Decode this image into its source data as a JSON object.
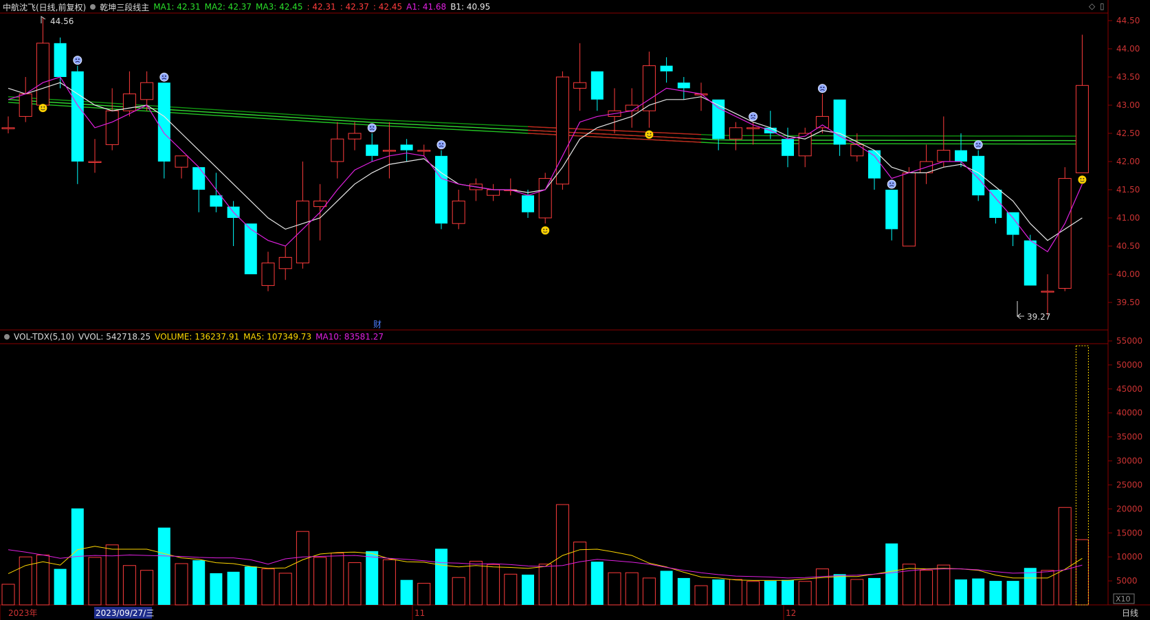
{
  "header": {
    "stock": "中航沈飞(日线,前复权)",
    "indicator": "乾坤三段线主",
    "ma1_label": "MA1: 42.31",
    "ma2_label": "MA2: 42.37",
    "ma3_label": "MA3: 42.45",
    "r1": ": 42.31",
    "r2": ": 42.37",
    "r3": ": 42.45",
    "a1_label": "A1: 41.68",
    "b1_label": "B1: 40.95"
  },
  "volume_header": {
    "name": "VOL-TDX(5,10)",
    "vvol": "VVOL: 542718.25",
    "volume": "VOLUME: 136237.91",
    "ma5": "MA5: 107349.73",
    "ma10": "MA10: 83581.27"
  },
  "annotations": {
    "high_label": "44.56",
    "low_label": "39.27",
    "fin_marker": "财"
  },
  "price_axis_ticks": [
    "44.50",
    "44.00",
    "43.50",
    "43.00",
    "42.50",
    "42.00",
    "41.50",
    "41.00",
    "40.50",
    "40.00",
    "39.50"
  ],
  "volume_axis_ticks": [
    "55000",
    "50000",
    "45000",
    "40000",
    "35000",
    "30000",
    "25000",
    "20000",
    "15000",
    "10000",
    "5000"
  ],
  "volume_multiplier": "X10",
  "date_axis": {
    "year": "2023年",
    "cursor": "2023/09/27/三",
    "m11": "11",
    "m12": "12"
  },
  "period_label": "日线",
  "colors": {
    "up": "#ff3c3c",
    "down": "#00ffff",
    "ma_white": "#e8e8e8",
    "ma_magenta": "#e020e0",
    "vol_ma5": "#ffd800",
    "grid_red": "#8a0000"
  },
  "chart_data": {
    "type": "candlestick",
    "price_range": [
      39.27,
      44.56
    ],
    "candles": [
      {
        "o": 42.6,
        "c": 42.6,
        "h": 42.8,
        "l": 42.5,
        "v": 4300,
        "m": false
      },
      {
        "o": 42.8,
        "c": 43.2,
        "h": 43.5,
        "l": 42.7,
        "v": 10000,
        "m": false
      },
      {
        "o": 43.0,
        "c": 44.1,
        "h": 44.56,
        "l": 42.9,
        "v": 10400,
        "m": true
      },
      {
        "o": 44.1,
        "c": 43.5,
        "h": 44.2,
        "l": 43.3,
        "v": 7500,
        "m": false
      },
      {
        "o": 43.6,
        "c": 42.0,
        "h": 43.7,
        "l": 41.6,
        "v": 20100,
        "m": false
      },
      {
        "o": 42.0,
        "c": 42.0,
        "h": 42.4,
        "l": 41.8,
        "v": 9900,
        "m": false
      },
      {
        "o": 42.3,
        "c": 42.9,
        "h": 43.3,
        "l": 42.2,
        "v": 12500,
        "m": false
      },
      {
        "o": 42.9,
        "c": 43.2,
        "h": 43.6,
        "l": 42.8,
        "v": 8200,
        "m": false
      },
      {
        "o": 43.1,
        "c": 43.4,
        "h": 43.6,
        "l": 42.9,
        "v": 7200,
        "m": false
      },
      {
        "o": 43.4,
        "c": 42.0,
        "h": 43.4,
        "l": 41.7,
        "v": 16100,
        "m": false
      },
      {
        "o": 41.9,
        "c": 42.1,
        "h": 42.1,
        "l": 41.7,
        "v": 8600,
        "m": false
      },
      {
        "o": 41.9,
        "c": 41.5,
        "h": 41.9,
        "l": 41.1,
        "v": 9300,
        "m": false
      },
      {
        "o": 41.4,
        "c": 41.2,
        "h": 41.8,
        "l": 41.1,
        "v": 6600,
        "m": false
      },
      {
        "o": 41.2,
        "c": 41.0,
        "h": 41.3,
        "l": 40.5,
        "v": 6900,
        "m": false
      },
      {
        "o": 40.9,
        "c": 40.0,
        "h": 40.9,
        "l": 40.0,
        "v": 8000,
        "m": false
      },
      {
        "o": 39.8,
        "c": 40.2,
        "h": 40.4,
        "l": 39.7,
        "v": 7500,
        "m": false
      },
      {
        "o": 40.1,
        "c": 40.3,
        "h": 40.5,
        "l": 39.9,
        "v": 6600,
        "m": false
      },
      {
        "o": 40.2,
        "c": 41.3,
        "h": 42.0,
        "l": 40.1,
        "v": 15300,
        "m": false
      },
      {
        "o": 41.2,
        "c": 41.3,
        "h": 41.6,
        "l": 40.6,
        "v": 9900,
        "m": false
      },
      {
        "o": 42.0,
        "c": 42.4,
        "h": 42.7,
        "l": 41.7,
        "v": 10800,
        "m": false
      },
      {
        "o": 42.4,
        "c": 42.5,
        "h": 42.7,
        "l": 42.2,
        "v": 8800,
        "m": false
      },
      {
        "o": 42.3,
        "c": 42.1,
        "h": 42.5,
        "l": 42.0,
        "v": 11200,
        "m": false
      },
      {
        "o": 42.2,
        "c": 42.2,
        "h": 42.7,
        "l": 41.7,
        "v": 9400,
        "m": false
      },
      {
        "o": 42.3,
        "c": 42.2,
        "h": 42.4,
        "l": 42.0,
        "v": 5200,
        "m": false
      },
      {
        "o": 42.2,
        "c": 42.2,
        "h": 42.3,
        "l": 42.1,
        "v": 4500,
        "m": false
      },
      {
        "o": 42.1,
        "c": 40.9,
        "h": 42.2,
        "l": 40.8,
        "v": 11700,
        "m": false
      },
      {
        "o": 40.9,
        "c": 41.3,
        "h": 41.5,
        "l": 40.8,
        "v": 5700,
        "m": false
      },
      {
        "o": 41.5,
        "c": 41.6,
        "h": 41.7,
        "l": 41.3,
        "v": 9100,
        "m": false
      },
      {
        "o": 41.4,
        "c": 41.5,
        "h": 41.6,
        "l": 41.3,
        "v": 8400,
        "m": false
      },
      {
        "o": 41.5,
        "c": 41.5,
        "h": 41.7,
        "l": 41.4,
        "v": 6400,
        "m": false
      },
      {
        "o": 41.4,
        "c": 41.1,
        "h": 41.5,
        "l": 41.0,
        "v": 6300,
        "m": false
      },
      {
        "o": 41.0,
        "c": 41.7,
        "h": 41.8,
        "l": 40.9,
        "v": 8500,
        "m": true
      },
      {
        "o": 41.6,
        "c": 43.5,
        "h": 43.6,
        "l": 41.5,
        "v": 20900,
        "m": false
      },
      {
        "o": 43.3,
        "c": 43.4,
        "h": 44.1,
        "l": 42.9,
        "v": 13100,
        "m": false
      },
      {
        "o": 43.6,
        "c": 43.1,
        "h": 43.6,
        "l": 42.9,
        "v": 9000,
        "m": false
      },
      {
        "o": 42.8,
        "c": 42.9,
        "h": 43.3,
        "l": 42.5,
        "v": 6700,
        "m": false
      },
      {
        "o": 42.9,
        "c": 43.0,
        "h": 43.3,
        "l": 42.6,
        "v": 6700,
        "m": false
      },
      {
        "o": 42.9,
        "c": 43.7,
        "h": 43.95,
        "l": 42.6,
        "v": 5600,
        "m": true
      },
      {
        "o": 43.7,
        "c": 43.6,
        "h": 43.85,
        "l": 43.4,
        "v": 7100,
        "m": false
      },
      {
        "o": 43.4,
        "c": 43.3,
        "h": 43.5,
        "l": 43.1,
        "v": 5600,
        "m": false
      },
      {
        "o": 43.2,
        "c": 43.2,
        "h": 43.4,
        "l": 42.9,
        "v": 4000,
        "m": false
      },
      {
        "o": 43.1,
        "c": 42.4,
        "h": 43.1,
        "l": 42.2,
        "v": 5300,
        "m": false
      },
      {
        "o": 42.4,
        "c": 42.6,
        "h": 42.7,
        "l": 42.2,
        "v": 5300,
        "m": false
      },
      {
        "o": 42.6,
        "c": 42.6,
        "h": 42.7,
        "l": 42.3,
        "v": 4900,
        "m": false
      },
      {
        "o": 42.6,
        "c": 42.5,
        "h": 42.9,
        "l": 42.4,
        "v": 5000,
        "m": false
      },
      {
        "o": 42.4,
        "c": 42.1,
        "h": 42.6,
        "l": 41.9,
        "v": 5200,
        "m": false
      },
      {
        "o": 42.1,
        "c": 42.5,
        "h": 42.6,
        "l": 41.9,
        "v": 4900,
        "m": false
      },
      {
        "o": 42.6,
        "c": 42.8,
        "h": 43.2,
        "l": 42.5,
        "v": 7500,
        "m": false
      },
      {
        "o": 43.1,
        "c": 42.3,
        "h": 43.1,
        "l": 42.1,
        "v": 6400,
        "m": false
      },
      {
        "o": 42.1,
        "c": 42.3,
        "h": 42.5,
        "l": 42.0,
        "v": 5300,
        "m": false
      },
      {
        "o": 42.2,
        "c": 41.7,
        "h": 42.2,
        "l": 41.5,
        "v": 5600,
        "m": false
      },
      {
        "o": 41.5,
        "c": 40.8,
        "h": 41.5,
        "l": 40.6,
        "v": 12800,
        "m": false
      },
      {
        "o": 40.5,
        "c": 41.8,
        "h": 41.9,
        "l": 40.5,
        "v": 8500,
        "m": false
      },
      {
        "o": 41.8,
        "c": 42.0,
        "h": 42.3,
        "l": 41.6,
        "v": 7200,
        "m": false
      },
      {
        "o": 42.0,
        "c": 42.2,
        "h": 42.8,
        "l": 41.9,
        "v": 8300,
        "m": false
      },
      {
        "o": 42.2,
        "c": 42.0,
        "h": 42.5,
        "l": 41.9,
        "v": 5300,
        "m": false
      },
      {
        "o": 42.1,
        "c": 41.4,
        "h": 42.2,
        "l": 41.3,
        "v": 5500,
        "m": false
      },
      {
        "o": 41.5,
        "c": 41.0,
        "h": 41.5,
        "l": 40.9,
        "v": 5000,
        "m": false
      },
      {
        "o": 41.1,
        "c": 40.7,
        "h": 41.1,
        "l": 40.5,
        "v": 5000,
        "m": false
      },
      {
        "o": 40.6,
        "c": 39.8,
        "h": 40.7,
        "l": 39.8,
        "v": 7700,
        "m": false
      },
      {
        "o": 39.7,
        "c": 39.7,
        "h": 40.0,
        "l": 39.27,
        "v": 7200,
        "m": false
      },
      {
        "o": 39.75,
        "c": 41.7,
        "h": 41.9,
        "l": 39.7,
        "v": 20300,
        "m": false
      },
      {
        "o": 41.8,
        "c": 43.35,
        "h": 44.25,
        "l": 41.8,
        "v": 13600,
        "m": true
      }
    ],
    "ma_white": [
      43.3,
      43.2,
      43.3,
      43.4,
      43.2,
      43.0,
      42.9,
      42.95,
      43.0,
      42.8,
      42.5,
      42.2,
      41.9,
      41.6,
      41.3,
      41.0,
      40.8,
      40.9,
      41.0,
      41.3,
      41.6,
      41.8,
      41.95,
      42.0,
      42.05,
      41.8,
      41.6,
      41.55,
      41.5,
      41.5,
      41.45,
      41.5,
      41.9,
      42.4,
      42.6,
      42.7,
      42.8,
      43.0,
      43.1,
      43.1,
      43.15,
      43.0,
      42.85,
      42.7,
      42.6,
      42.45,
      42.4,
      42.55,
      42.5,
      42.35,
      42.2,
      41.9,
      41.8,
      41.8,
      41.9,
      41.95,
      41.8,
      41.55,
      41.3,
      40.9,
      40.6,
      40.8,
      41.0
    ],
    "ma_magenta": [
      43.1,
      43.2,
      43.4,
      43.5,
      43.0,
      42.6,
      42.7,
      42.85,
      43.0,
      42.5,
      42.2,
      41.9,
      41.5,
      41.1,
      40.8,
      40.6,
      40.5,
      40.8,
      41.1,
      41.5,
      41.85,
      42.0,
      42.1,
      42.15,
      42.1,
      41.7,
      41.6,
      41.55,
      41.5,
      41.5,
      41.4,
      41.5,
      42.1,
      42.7,
      42.8,
      42.85,
      42.9,
      43.1,
      43.3,
      43.25,
      43.2,
      42.95,
      42.8,
      42.65,
      42.55,
      42.4,
      42.45,
      42.65,
      42.45,
      42.3,
      42.1,
      41.7,
      41.8,
      41.9,
      42.0,
      42.0,
      41.7,
      41.35,
      41.0,
      40.6,
      40.4,
      40.9,
      41.6
    ],
    "band_lines": [
      {
        "name": "MA1",
        "values": [
          43.05,
          42.65,
          42.32,
          42.31
        ]
      },
      {
        "name": "MA2",
        "values": [
          43.1,
          42.7,
          42.38,
          42.37
        ]
      },
      {
        "name": "MA3",
        "values": [
          43.15,
          42.75,
          42.46,
          42.45
        ]
      }
    ],
    "vol_ma5": [
      6500,
      8200,
      9000,
      8300,
      11500,
      12200,
      11600,
      11600,
      11600,
      10700,
      9800,
      9500,
      8800,
      8600,
      8000,
      7600,
      7700,
      9400,
      10600,
      10900,
      11000,
      10700,
      9600,
      9000,
      8900,
      8300,
      7900,
      8200,
      7900,
      7800,
      7600,
      8000,
      10300,
      11500,
      11600,
      11000,
      10300,
      8700,
      7900,
      6800,
      5800,
      5600,
      5200,
      5100,
      5100,
      5100,
      5400,
      5700,
      5900,
      5900,
      6400,
      7000,
      7600,
      7500,
      7600,
      7500,
      7200,
      6200,
      5600,
      5600,
      5600,
      7400,
      9700
    ],
    "vol_ma10": [
      11500,
      11000,
      10400,
      9700,
      10100,
      10300,
      10200,
      10400,
      10300,
      10200,
      10100,
      9900,
      9800,
      9800,
      9400,
      8500,
      9600,
      10000,
      10100,
      10200,
      10300,
      10000,
      9700,
      9500,
      9200,
      8800,
      8700,
      8500,
      8600,
      8400,
      8100,
      8000,
      8200,
      9000,
      9500,
      9200,
      8900,
      8500,
      7800,
      7200,
      6700,
      6300,
      6000,
      5900,
      5800,
      5600,
      5700,
      5900,
      6100,
      6200,
      6400,
      6700,
      7100,
      7400,
      7500,
      7500,
      7300,
      6900,
      6600,
      6700,
      6900,
      7300,
      8300
    ]
  }
}
